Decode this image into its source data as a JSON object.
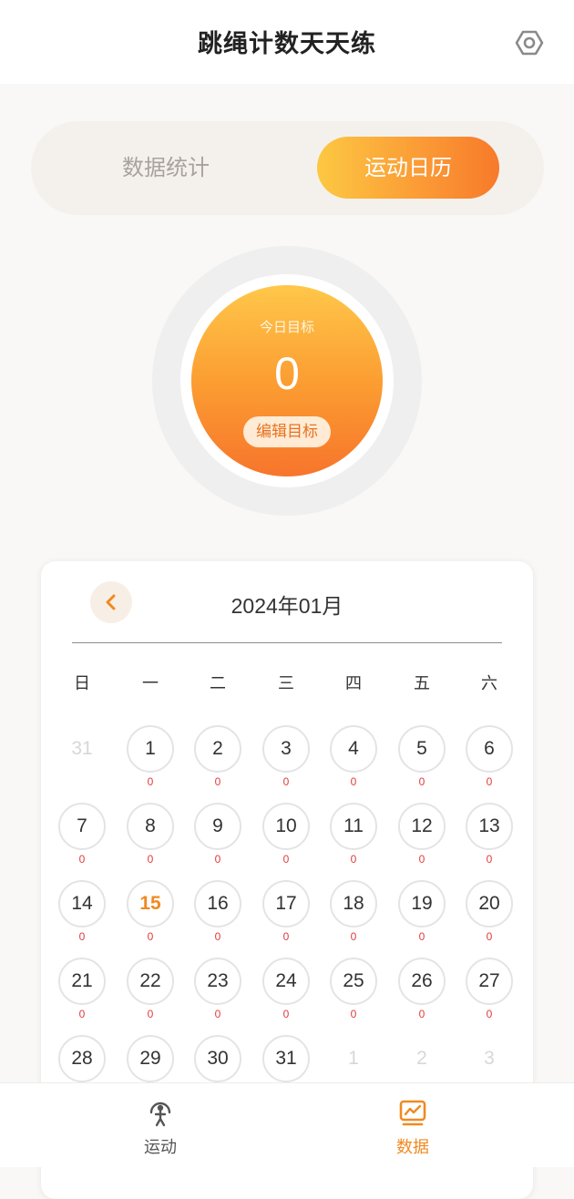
{
  "header": {
    "title": "跳绳计数天天练",
    "settings_icon": "settings-icon"
  },
  "tabs": [
    {
      "label": "数据统计",
      "active": false
    },
    {
      "label": "运动日历",
      "active": true
    }
  ],
  "goal": {
    "label": "今日目标",
    "value": "0",
    "edit_label": "编辑目标"
  },
  "calendar": {
    "month_title": "2024年01月",
    "prev_icon": "chevron-left-icon",
    "weekdays": [
      "日",
      "一",
      "二",
      "三",
      "四",
      "五",
      "六"
    ],
    "days": [
      {
        "day": "31",
        "count": "",
        "other": true
      },
      {
        "day": "1",
        "count": "0"
      },
      {
        "day": "2",
        "count": "0"
      },
      {
        "day": "3",
        "count": "0"
      },
      {
        "day": "4",
        "count": "0"
      },
      {
        "day": "5",
        "count": "0"
      },
      {
        "day": "6",
        "count": "0"
      },
      {
        "day": "7",
        "count": "0"
      },
      {
        "day": "8",
        "count": "0"
      },
      {
        "day": "9",
        "count": "0"
      },
      {
        "day": "10",
        "count": "0"
      },
      {
        "day": "11",
        "count": "0"
      },
      {
        "day": "12",
        "count": "0"
      },
      {
        "day": "13",
        "count": "0"
      },
      {
        "day": "14",
        "count": "0"
      },
      {
        "day": "15",
        "count": "0",
        "today": true
      },
      {
        "day": "16",
        "count": "0"
      },
      {
        "day": "17",
        "count": "0"
      },
      {
        "day": "18",
        "count": "0"
      },
      {
        "day": "19",
        "count": "0"
      },
      {
        "day": "20",
        "count": "0"
      },
      {
        "day": "21",
        "count": "0"
      },
      {
        "day": "22",
        "count": "0"
      },
      {
        "day": "23",
        "count": "0"
      },
      {
        "day": "24",
        "count": "0"
      },
      {
        "day": "25",
        "count": "0"
      },
      {
        "day": "26",
        "count": "0"
      },
      {
        "day": "27",
        "count": "0"
      },
      {
        "day": "28",
        "count": ""
      },
      {
        "day": "29",
        "count": ""
      },
      {
        "day": "30",
        "count": ""
      },
      {
        "day": "31",
        "count": ""
      },
      {
        "day": "1",
        "count": "",
        "other": true
      },
      {
        "day": "2",
        "count": "",
        "other": true
      },
      {
        "day": "3",
        "count": "",
        "other": true
      }
    ]
  },
  "nav": [
    {
      "label": "运动",
      "icon": "jump-rope-person-icon",
      "active": false
    },
    {
      "label": "数据",
      "icon": "chart-monitor-icon",
      "active": true
    }
  ],
  "colors": {
    "accent": "#f08a21",
    "accent_gradient_start": "#fcc842",
    "accent_gradient_end": "#f77a2b",
    "count_red": "#e03c3c",
    "nav_inactive": "#555555"
  }
}
